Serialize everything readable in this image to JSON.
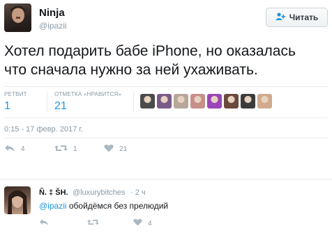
{
  "tweet": {
    "author": {
      "name": "Ninja",
      "handle": "@ipazii"
    },
    "follow_label": "Читать",
    "text": "Хотел подарить бабе iPhone, но оказалась\nчто сначала нужно за ней ухаживать.",
    "stats": {
      "retweets_label": "РЕТВИТ",
      "retweets_count": "1",
      "likes_label": "ОТМЕТКА «НРАВИТСЯ»",
      "likes_count": "21"
    },
    "timestamp": "0:15 - 17 февр. 2017 г.",
    "actions": {
      "reply_count": "4",
      "retweet_count": "1",
      "like_count": "21"
    }
  },
  "likers": [
    {
      "name": "liker-1",
      "color": "#4b4b4b"
    },
    {
      "name": "liker-2",
      "color": "#7b5a8a"
    },
    {
      "name": "liker-3",
      "color": "#b9a69a"
    },
    {
      "name": "liker-4",
      "color": "#c78f8a"
    },
    {
      "name": "liker-5",
      "color": "#9b46b8"
    },
    {
      "name": "liker-6",
      "color": "#6b4a3c"
    },
    {
      "name": "liker-7",
      "color": "#3c3c3c"
    },
    {
      "name": "liker-8",
      "color": "#d1a98c"
    }
  ],
  "reply": {
    "name": "Ñ. ‡ ŠH.",
    "handle": "@luxurybitches",
    "time": "· 2 ч",
    "mention": "@ipazii",
    "text": " обойдёмся без прелюдий",
    "actions": {
      "reply_count": "",
      "retweet_count": "",
      "like_count": "4"
    }
  },
  "colors": {
    "accent": "#1b95e0",
    "muted": "#8899a6",
    "divider": "#e6ecf0"
  }
}
